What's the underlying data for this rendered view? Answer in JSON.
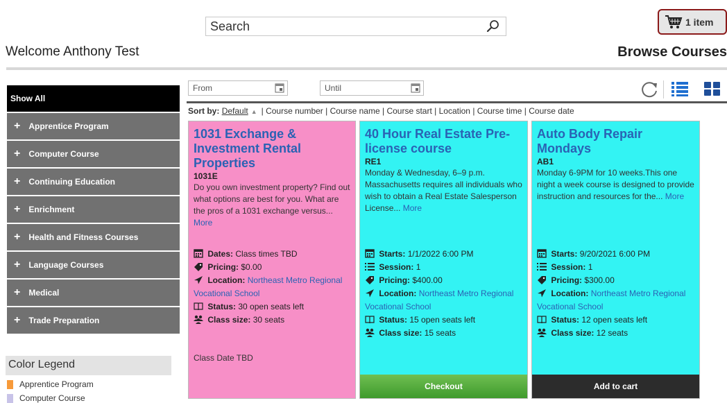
{
  "search": {
    "placeholder": "Search"
  },
  "cart": {
    "count_label": "1 item"
  },
  "welcome": "Welcome Anthony Test",
  "page_heading": "Browse Courses",
  "filters": {
    "from_placeholder": "From",
    "until_placeholder": "Until"
  },
  "sort": {
    "label": "Sort by:",
    "options": [
      "Default",
      "Course number",
      "Course name",
      "Course start",
      "Location",
      "Course time",
      "Course date"
    ]
  },
  "sidebar": {
    "show_all": "Show All",
    "categories": [
      "Apprentice Program",
      "Computer Course",
      "Continuing Education",
      "Enrichment",
      "Health and Fitness Courses",
      "Language Courses",
      "Medical",
      "Trade Preparation"
    ]
  },
  "legend": {
    "title": "Color Legend",
    "items": [
      {
        "label": "Apprentice Program",
        "color": "#f79a3a"
      },
      {
        "label": "Computer Course",
        "color": "#c8c3e8"
      }
    ]
  },
  "courses": [
    {
      "title": "1031 Exchange & Investment Rental Properties",
      "code": "1031E",
      "description": "Do you own investment property? Find out what options are best for you. What are the pros of a 1031 exchange versus...",
      "more": "More",
      "dates_label": "Dates:",
      "dates": "Class times TBD",
      "pricing_label": "Pricing:",
      "pricing": "$0.00",
      "location_label": "Location:",
      "location": "Northeast Metro Regional Vocational School",
      "status_label": "Status:",
      "status": "30 open seats left",
      "size_label": "Class size:",
      "size": "30 seats",
      "class_date": "Class Date TBD",
      "color": "#f78fc7"
    },
    {
      "title": "40 Hour Real Estate Pre-license course",
      "code": "RE1",
      "description": "Monday & Wednesday, 6–9 p.m. Massachusetts requires all individuals who wish to obtain a Real Estate Salesperson License...",
      "more": "More",
      "starts_label": "Starts:",
      "starts": "1/1/2022 6:00 PM",
      "session_label": "Session:",
      "session": "1",
      "pricing_label": "Pricing:",
      "pricing": "$400.00",
      "location_label": "Location:",
      "location": "Northeast Metro Regional Vocational School",
      "status_label": "Status:",
      "status": "15 open seats left",
      "size_label": "Class size:",
      "size": "15 seats",
      "button": "Checkout",
      "color": "#33f3f3"
    },
    {
      "title": "Auto Body Repair Mondays",
      "code": "AB1",
      "description": "Monday 6-9PM for 10 weeks.This one night a week course is designed to provide instruction and resources for the...",
      "more": "More",
      "starts_label": "Starts:",
      "starts": "9/20/2021 6:00 PM",
      "session_label": "Session:",
      "session": "1",
      "pricing_label": "Pricing:",
      "pricing": "$300.00",
      "location_label": "Location:",
      "location": "Northeast Metro Regional Vocational School",
      "status_label": "Status:",
      "status": "12 open seats left",
      "size_label": "Class size:",
      "size": "12 seats",
      "button": "Add to cart",
      "color": "#33f3f3"
    }
  ],
  "colors": {
    "link": "#2a62b4",
    "checkout": "#4ca836",
    "cart_border": "#8b1a1a"
  },
  "icons": [
    "search-icon",
    "cart-icon",
    "calendar-icon",
    "refresh-icon",
    "list-view-icon",
    "grid-view-icon",
    "tag-icon",
    "location-arrow-icon",
    "book-icon",
    "people-icon",
    "session-list-icon"
  ]
}
